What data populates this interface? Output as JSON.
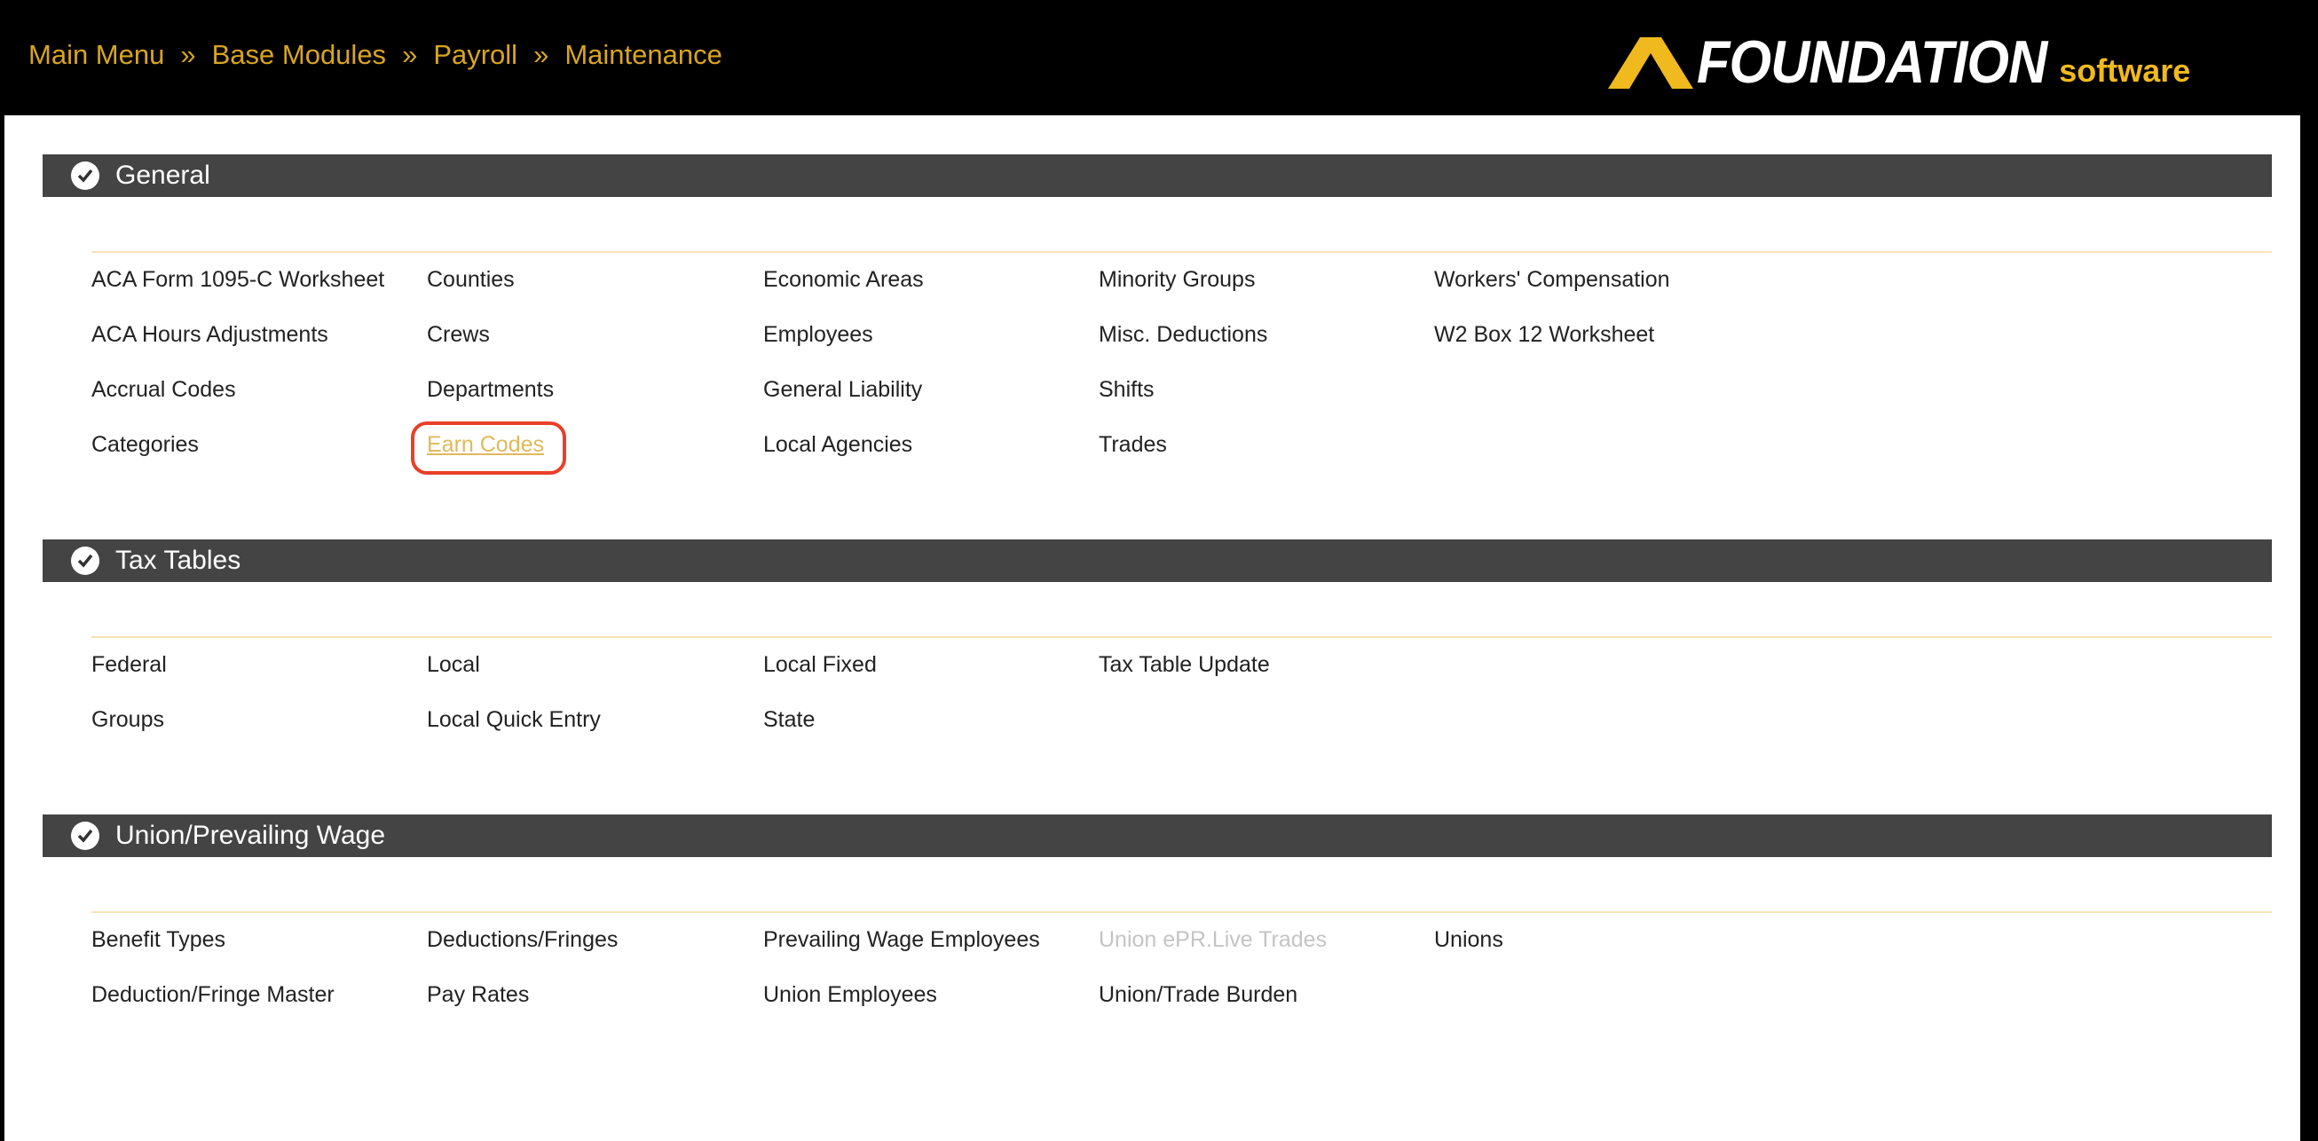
{
  "breadcrumb": [
    "Main Menu",
    "Base Modules",
    "Payroll",
    "Maintenance"
  ],
  "breadcrumb_separator": "»",
  "logo": {
    "word": "FOUNDATION",
    "suffix": "software"
  },
  "colors": {
    "breadcrumb": "#d9a520",
    "section_bar": "#444444",
    "visited_link": "#e0b95a",
    "disabled": "#c4c4c4",
    "highlight": "#e8402a"
  },
  "sections": [
    {
      "title": "General",
      "columns": [
        [
          "ACA Form 1095-C Worksheet",
          "ACA Hours Adjustments",
          "Accrual Codes",
          "Categories"
        ],
        [
          "Counties",
          "Crews",
          "Departments",
          "Earn Codes"
        ],
        [
          "Economic Areas",
          "Employees",
          "General Liability",
          "Local Agencies"
        ],
        [
          "Minority Groups",
          "Misc. Deductions",
          "Shifts",
          "Trades"
        ],
        [
          "Workers' Compensation",
          "W2 Box 12 Worksheet"
        ]
      ]
    },
    {
      "title": "Tax Tables",
      "columns": [
        [
          "Federal",
          "Groups"
        ],
        [
          "Local",
          "Local Quick Entry"
        ],
        [
          "Local Fixed",
          "State"
        ],
        [
          "Tax Table Update"
        ]
      ]
    },
    {
      "title": "Union/Prevailing Wage",
      "columns": [
        [
          "Benefit Types",
          "Deduction/Fringe Master"
        ],
        [
          "Deductions/Fringes",
          "Pay Rates"
        ],
        [
          "Prevailing Wage Employees",
          "Union Employees"
        ],
        [
          "Union ePR.Live Trades",
          "Union/Trade Burden"
        ],
        [
          "Unions"
        ]
      ]
    }
  ],
  "visited_item": "Earn Codes",
  "disabled_item": "Union ePR.Live Trades",
  "highlighted_item": "Earn Codes"
}
